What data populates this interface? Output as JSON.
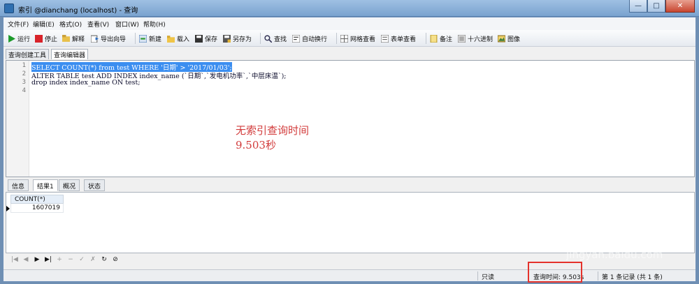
{
  "window": {
    "title": "索引 @dianchang (localhost) - 查询",
    "minimize": "—",
    "maximize": "□",
    "close": "✕"
  },
  "menu": [
    "文件(F)",
    "编辑(E)",
    "格式(O)",
    "查看(V)",
    "窗口(W)",
    "帮助(H)"
  ],
  "toolbar": {
    "run": "运行",
    "stop": "停止",
    "explain": "解释",
    "export": "导出向导",
    "new": "新建",
    "load": "载入",
    "save": "保存",
    "save_as": "另存为",
    "find": "查找",
    "wrap": "自动换行",
    "grid_view": "网格查看",
    "form_view": "表单查看",
    "memo": "备注",
    "hex": "十六进制",
    "image": "图像"
  },
  "doc_tabs": [
    "查询创建工具",
    "查询编辑器"
  ],
  "editor": {
    "lines": [
      {
        "n": "1",
        "text": "SELECT COUNT(*) from test WHERE '日期' > '2017/01/03';"
      },
      {
        "n": "2",
        "text": "ALTER TABLE test ADD INDEX index_name (`日期`,`发电机功率`,`中层床温`);"
      },
      {
        "n": "3",
        "text": "drop index index_name ON test;"
      },
      {
        "n": "4",
        "text": ""
      }
    ],
    "annotation_line1": "无索引查询时间",
    "annotation_line2": "9.503秒"
  },
  "result_tabs": [
    "信息",
    "结果1",
    "概况",
    "状态"
  ],
  "grid": {
    "column": "COUNT(*)",
    "value": "1607019"
  },
  "nav_buttons": [
    "|◀",
    "◀",
    "▶",
    "▶|",
    "+",
    "−",
    "✓",
    "✗",
    "↻",
    "⊘"
  ],
  "status": {
    "mode": "只读",
    "query_time": "查询时间: 9.503s",
    "records": "第 1 条记录 (共 1 条)"
  },
  "watermark": {
    "text": "Bai 经验",
    "sub": "jingyan.baidu.com"
  },
  "colors": {
    "selection": "#3b8ef0",
    "annotation": "#d23b3b",
    "highlight_box": "#e4322b"
  }
}
